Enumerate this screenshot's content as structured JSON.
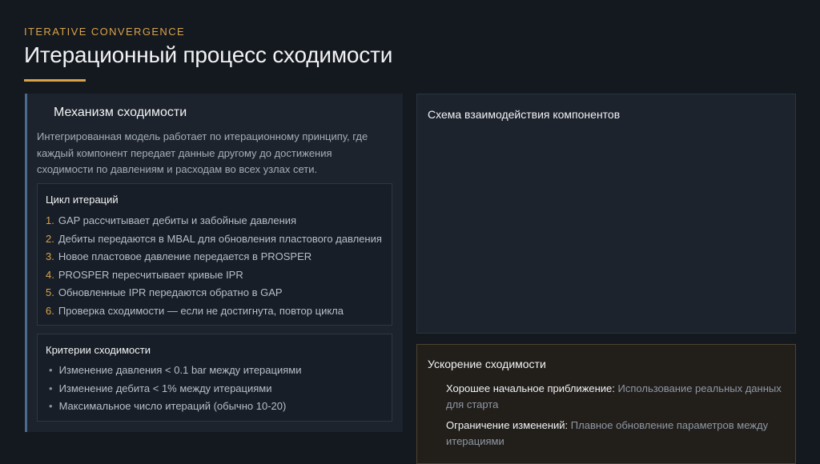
{
  "header": {
    "eyebrow": "ITERATIVE CONVERGENCE",
    "title": "Итерационный процесс сходимости"
  },
  "mechanism": {
    "title": "Механизм сходимости",
    "description": "Интегрированная модель работает по итерационному принципу, где каждый компонент передает данные другому до достижения сходимости по давлениям и расходам во всех узлах сети.",
    "cycle": {
      "title": "Цикл итераций",
      "steps": [
        {
          "num": "1.",
          "text": "GAP рассчитывает дебиты и забойные давления"
        },
        {
          "num": "2.",
          "text": "Дебиты передаются в MBAL для обновления пластового давления"
        },
        {
          "num": "3.",
          "text": "Новое пластовое давление передается в PROSPER"
        },
        {
          "num": "4.",
          "text": "PROSPER пересчитывает кривые IPR"
        },
        {
          "num": "5.",
          "text": "Обновленные IPR передаются обратно в GAP"
        },
        {
          "num": "6.",
          "text": "Проверка сходимости — если не достигнута, повтор цикла"
        }
      ]
    },
    "criteria": {
      "title": "Критерии сходимости",
      "bullet": "•",
      "items": [
        "Изменение давления < 0.1 bar между итерациями",
        "Изменение дебита < 1% между итерациями",
        "Максимальное число итераций (обычно 10-20)"
      ]
    }
  },
  "diagram": {
    "title": "Схема взаимодействия компонентов"
  },
  "acceleration": {
    "title": "Ускорение сходимости",
    "items": [
      {
        "label": "Хорошее начальное приближение:",
        "text": "Использование реальных данных для старта"
      },
      {
        "label": "Ограничение изменений:",
        "text": "Плавное обновление параметров между итерациями"
      }
    ]
  },
  "colors": {
    "accent": "#d9a34a",
    "background": "#14181f",
    "panel": "#1c232d"
  }
}
